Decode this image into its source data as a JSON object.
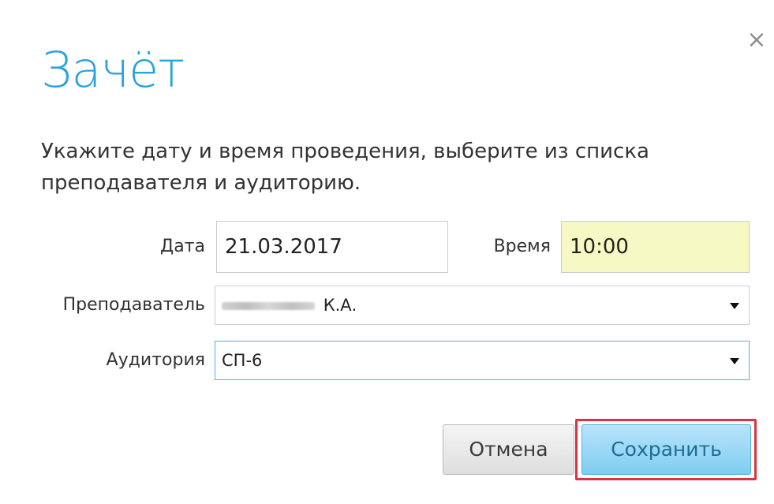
{
  "dialog": {
    "title": "Зачёт",
    "close_icon": "×",
    "instruction": "Укажите дату и время проведения, выберите из списка преподавателя и аудиторию."
  },
  "form": {
    "date_label": "Дата",
    "date_value": "21.03.2017",
    "time_label": "Время",
    "time_value": "10:00",
    "teacher_label": "Преподаватель",
    "teacher_value": "К.А.",
    "room_label": "Аудитория",
    "room_value": "СП-6"
  },
  "buttons": {
    "cancel": "Отмена",
    "save": "Сохранить"
  },
  "colors": {
    "accent": "#2aa3dd",
    "time_field_bg": "#f7f9c4",
    "save_highlight": "#d83441"
  },
  "icons": {
    "close": "close-icon",
    "dropdown": "dropdown-arrow-icon"
  }
}
